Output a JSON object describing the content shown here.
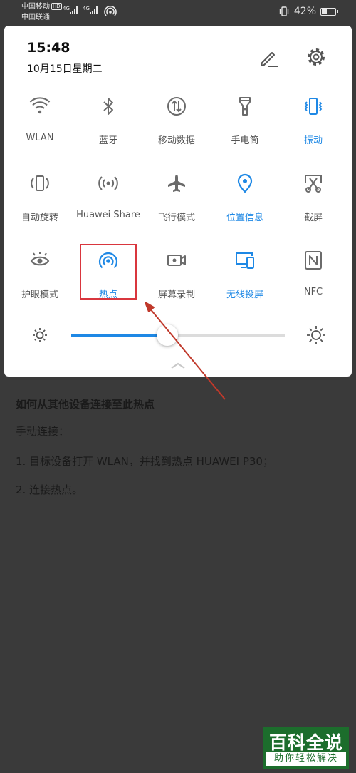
{
  "status_bar": {
    "carrier1": "中国移动",
    "carrier1_badge": "HD",
    "carrier2": "中国联通",
    "network1": "4G",
    "network2": "4G",
    "battery_percent": "42%",
    "battery_level": 0.42
  },
  "panel": {
    "time": "15:48",
    "date": "10月15日星期二",
    "tiles": [
      {
        "label": "WLAN",
        "icon": "wifi-icon",
        "active": false
      },
      {
        "label": "蓝牙",
        "icon": "bluetooth-icon",
        "active": false
      },
      {
        "label": "移动数据",
        "icon": "mobile-data-icon",
        "active": false
      },
      {
        "label": "手电筒",
        "icon": "flashlight-icon",
        "active": false
      },
      {
        "label": "振动",
        "icon": "vibrate-icon",
        "active": true
      },
      {
        "label": "自动旋转",
        "icon": "auto-rotate-icon",
        "active": false
      },
      {
        "label": "Huawei Share",
        "icon": "huawei-share-icon",
        "active": false
      },
      {
        "label": "飞行模式",
        "icon": "airplane-icon",
        "active": false
      },
      {
        "label": "位置信息",
        "icon": "location-icon",
        "active": true
      },
      {
        "label": "截屏",
        "icon": "screenshot-icon",
        "active": false
      },
      {
        "label": "护眼模式",
        "icon": "eye-comfort-icon",
        "active": false
      },
      {
        "label": "热点",
        "icon": "hotspot-icon",
        "active": true
      },
      {
        "label": "屏幕录制",
        "icon": "screen-record-icon",
        "active": false
      },
      {
        "label": "无线投屏",
        "icon": "wireless-projection-icon",
        "active": true
      },
      {
        "label": "NFC",
        "icon": "nfc-icon",
        "active": false
      }
    ],
    "brightness_level": 0.45
  },
  "article": {
    "title": "如何从其他设备连接至此热点",
    "subtitle": "手动连接：",
    "steps": [
      "1. 目标设备打开 WLAN，并找到热点 HUAWEI P30；",
      "2. 连接热点。"
    ]
  },
  "watermark": {
    "main": "百科全说",
    "sub": "助你轻松解决"
  },
  "colors": {
    "accent": "#1e88e5",
    "icon_gray": "#6b6b6b",
    "highlight": "#d9363e",
    "arrow": "#c0392b",
    "watermark_green": "#1c6d2c"
  }
}
